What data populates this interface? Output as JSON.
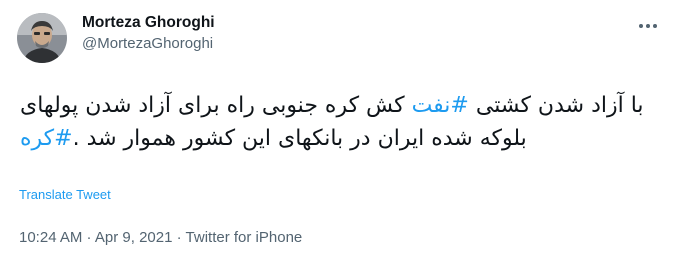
{
  "author": {
    "name": "Morteza Ghoroghi",
    "handle": "@MortezaGhoroghi"
  },
  "tweet": {
    "parts": [
      {
        "text": "با آزاد شدن کشتی ",
        "type": "text"
      },
      {
        "text": "#نفت",
        "type": "hashtag"
      },
      {
        "text": " کش کره جنوبی راه برای آزاد شدن پولهای بلوکه شده ایران در بانکهای این کشور هموار شد .",
        "type": "text"
      },
      {
        "text": "#کره",
        "type": "hashtag"
      }
    ]
  },
  "translate_label": "Translate Tweet",
  "meta": {
    "time": "10:24 AM",
    "separator": " · ",
    "date": "Apr 9, 2021",
    "source": "Twitter for iPhone"
  },
  "colors": {
    "link": "#1d9bf0",
    "secondary_text": "#536471",
    "primary_text": "#0f1419"
  },
  "icons": {
    "avatar": "profile-photo",
    "more": "more-horizontal-icon"
  }
}
